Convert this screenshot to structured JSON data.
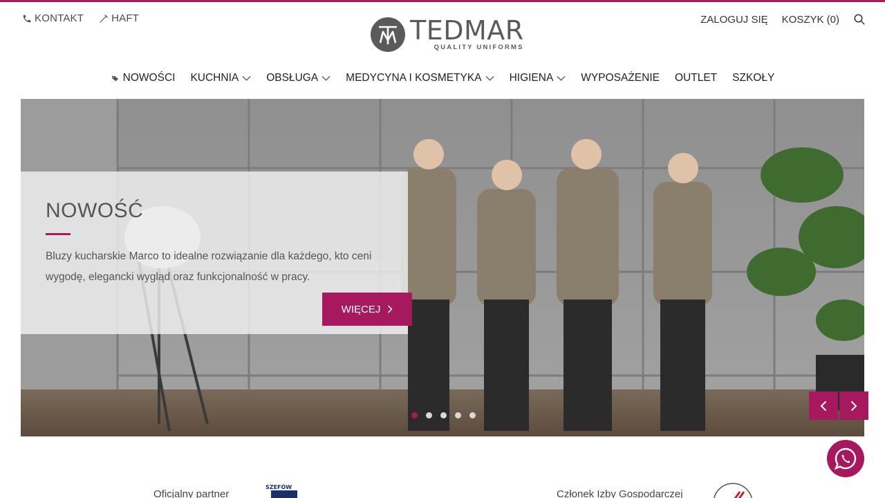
{
  "colors": {
    "accent": "#a6195f",
    "text": "#333333"
  },
  "util_left": {
    "contact": {
      "label": "KONTAKT",
      "icon": "phone-icon"
    },
    "embroidery": {
      "label": "HAFT",
      "icon": "needle-icon"
    }
  },
  "logo": {
    "name": "TEDMAR",
    "tagline": "QUALITY UNIFORMS"
  },
  "util_right": {
    "login": "ZALOGUJ SIĘ",
    "cart": "KOSZYK (0)",
    "search_icon": "search-icon"
  },
  "nav": [
    {
      "label": "NOWOŚCI",
      "icon": "tag-icon"
    },
    {
      "label": "KUCHNIA",
      "dropdown": true
    },
    {
      "label": "OBSŁUGA",
      "dropdown": true
    },
    {
      "label": "MEDYCYNA I KOSMETYKA",
      "dropdown": true
    },
    {
      "label": "HIGIENA",
      "dropdown": true
    },
    {
      "label": "WYPOSAŻENIE"
    },
    {
      "label": "OUTLET"
    },
    {
      "label": "SZKOŁY"
    }
  ],
  "hero": {
    "title": "NOWOŚĆ",
    "text": "Bluzy kucharskie Marco to idealne rozwiązanie dla każdego, kto ceni wygodę, elegancki wygląd oraz funkcjonalność w pracy.",
    "button": "WIĘCEJ",
    "slides": 5,
    "active_slide": 1
  },
  "partners": {
    "left": "Oficjalny partner",
    "left_logo_text": "SZEFÓW",
    "right": "Członek Izby Gospodarczej"
  }
}
